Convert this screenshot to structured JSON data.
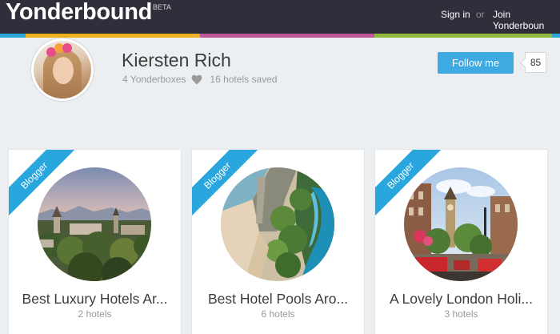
{
  "header": {
    "logo": "Yonderbound",
    "beta": "BETA",
    "sign_in": "Sign in",
    "or": "or",
    "join": "Join Yonderboun"
  },
  "profile": {
    "name": "Kiersten Rich",
    "yonderboxes": "4 Yonderboxes",
    "hotels_saved": "16 hotels saved",
    "follow_label": "Follow me",
    "follow_count": "85"
  },
  "cards": [
    {
      "badge": "Blogger",
      "title": "Best Luxury Hotels Ar...",
      "subtitle": "2 hotels",
      "image": "town-sunset-photo"
    },
    {
      "badge": "Blogger",
      "title": "Best Hotel Pools Aro...",
      "subtitle": "6 hotels",
      "image": "infinity-pool-photo"
    },
    {
      "badge": "Blogger",
      "title": "A Lovely London Holi...",
      "subtitle": "3 hotels",
      "image": "london-street-photo"
    }
  ],
  "colors": {
    "topbar": "#2f2f3b",
    "stripes": [
      "#27a6d7",
      "#f0b01e",
      "#c1569b",
      "#8fb93c",
      "#27a6d7"
    ],
    "accent": "#3fa9e1",
    "ribbon": "#29a6dd",
    "background": "#eceff1"
  }
}
